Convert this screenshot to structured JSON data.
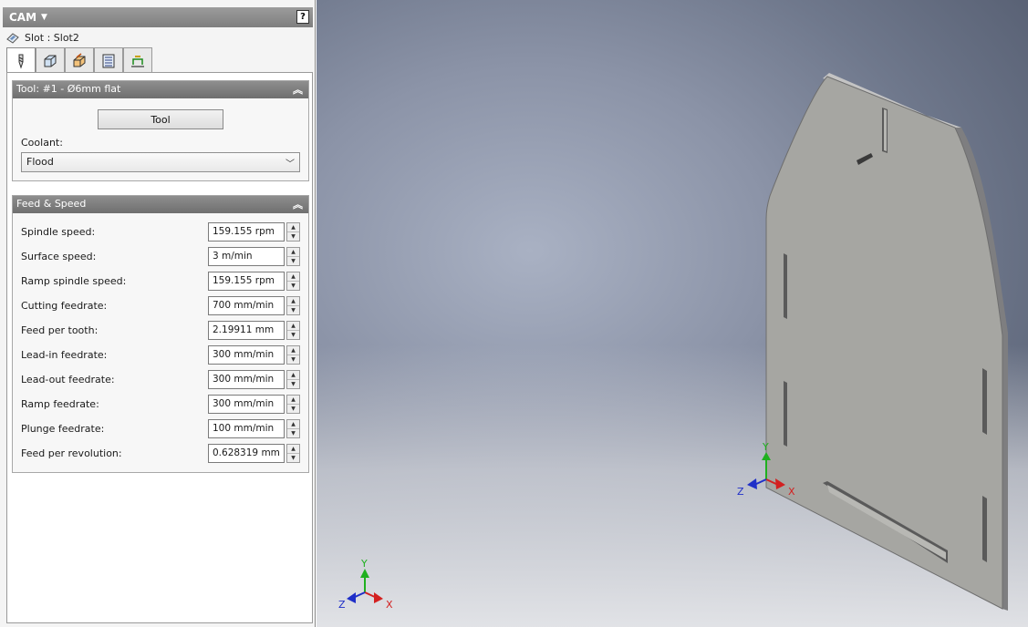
{
  "header": {
    "title": "CAM",
    "help": "?"
  },
  "operation": {
    "label": "Slot : Slot2"
  },
  "tabs": [
    {
      "name": "tool-tab",
      "icon": "tool-icon"
    },
    {
      "name": "geometry-tab",
      "icon": "geometry-icon"
    },
    {
      "name": "heights-tab",
      "icon": "heights-icon"
    },
    {
      "name": "passes-tab",
      "icon": "passes-icon"
    },
    {
      "name": "linking-tab",
      "icon": "linking-icon"
    }
  ],
  "tool_group": {
    "title": "Tool: #1 - Ø6mm flat",
    "tool_button": "Tool",
    "coolant_label": "Coolant:",
    "coolant_value": "Flood"
  },
  "feed_group": {
    "title": "Feed & Speed",
    "rows": [
      {
        "label": "Spindle speed:",
        "value": "159.155 rpm"
      },
      {
        "label": "Surface speed:",
        "value": "3 m/min"
      },
      {
        "label": "Ramp spindle speed:",
        "value": "159.155 rpm"
      },
      {
        "label": "Cutting feedrate:",
        "value": "700 mm/min"
      },
      {
        "label": "Feed per tooth:",
        "value": "2.19911 mm"
      },
      {
        "label": "Lead-in feedrate:",
        "value": "300 mm/min"
      },
      {
        "label": "Lead-out feedrate:",
        "value": "300 mm/min"
      },
      {
        "label": "Ramp feedrate:",
        "value": "300 mm/min"
      },
      {
        "label": "Plunge feedrate:",
        "value": "100 mm/min"
      },
      {
        "label": "Feed per revolution:",
        "value": "0.628319 mm"
      }
    ]
  },
  "viewport": {
    "triad": {
      "x": "X",
      "y": "Y",
      "z": "Z"
    },
    "colors": {
      "x": "#d32020",
      "y": "#1fb01f",
      "z": "#1f2fc8"
    }
  }
}
